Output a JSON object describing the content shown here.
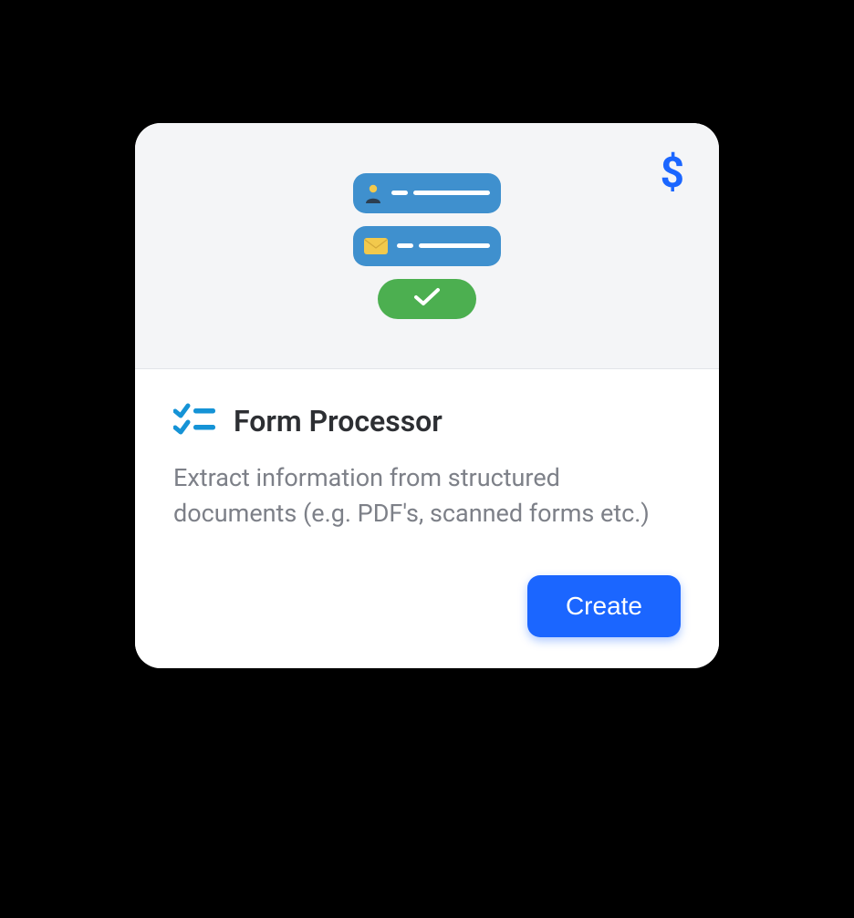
{
  "card": {
    "title": "Form Processor",
    "description": "Extract information from structured documents (e.g. PDF's, scanned forms etc.)",
    "action_label": "Create",
    "pricing_icon": "$",
    "colors": {
      "primary": "#1B66FF",
      "field": "#3F90CE",
      "confirm": "#4CAF50"
    }
  }
}
